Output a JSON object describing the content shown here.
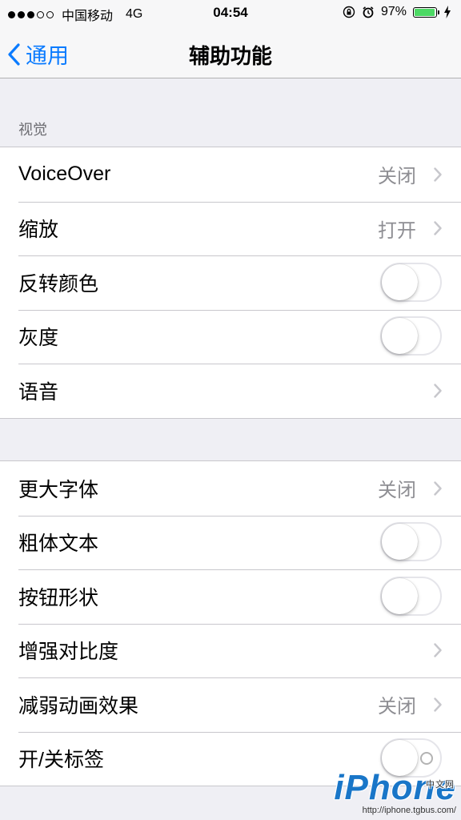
{
  "status_bar": {
    "signal_dots": [
      true,
      true,
      true,
      false,
      false
    ],
    "carrier": "中国移动",
    "network": "4G",
    "time": "04:54",
    "battery_percent": "97%",
    "battery_level": 0.97,
    "icons": [
      "orientation-lock-icon",
      "alarm-icon",
      "charging-icon"
    ]
  },
  "nav": {
    "back_label": "通用",
    "title": "辅助功能"
  },
  "vision_section": {
    "header": "视觉",
    "rows": [
      {
        "label": "VoiceOver",
        "value": "关闭",
        "type": "disclosure"
      },
      {
        "label": "缩放",
        "value": "打开",
        "type": "disclosure"
      },
      {
        "label": "反转颜色",
        "type": "toggle",
        "on": false
      },
      {
        "label": "灰度",
        "type": "toggle",
        "on": false
      },
      {
        "label": "语音",
        "value": "",
        "type": "disclosure"
      }
    ]
  },
  "text_section": {
    "rows": [
      {
        "label": "更大字体",
        "value": "关闭",
        "type": "disclosure"
      },
      {
        "label": "粗体文本",
        "type": "toggle",
        "on": false
      },
      {
        "label": "按钮形状",
        "type": "toggle",
        "on": false
      },
      {
        "label": "增强对比度",
        "value": "",
        "type": "disclosure"
      },
      {
        "label": "减弱动画效果",
        "value": "关闭",
        "type": "disclosure"
      },
      {
        "label": "开/关标签",
        "type": "toggle",
        "on": false
      }
    ]
  },
  "watermark": {
    "logo": "iPhone",
    "badge": "中文网",
    "url": "http://iphone.tgbus.com/"
  },
  "colors": {
    "accent": "#0a7bff",
    "background": "#efeff4",
    "battery": "#4cd964",
    "secondary_text": "#8e8e93"
  }
}
